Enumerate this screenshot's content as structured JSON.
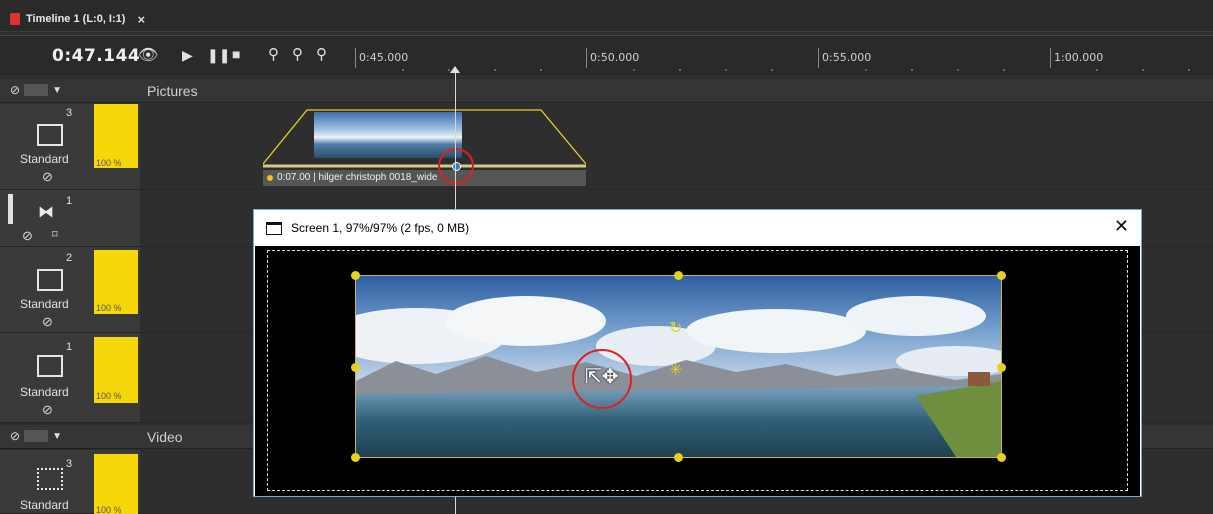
{
  "tab": {
    "title": "Timeline 1 (L:0, I:1)",
    "close": "×"
  },
  "transport": {
    "time": "0:47.144",
    "ruler": [
      "0:45.000",
      "0:50.000",
      "0:55.000",
      "1:00.000"
    ]
  },
  "groups": [
    {
      "title": "Pictures"
    },
    {
      "title": "Video"
    }
  ],
  "tracks": [
    {
      "number": "3",
      "mode": "Standard",
      "opacity": "100 %"
    },
    {
      "number": "1"
    },
    {
      "number": "2",
      "mode": "Standard",
      "opacity": "100 %"
    },
    {
      "number": "1",
      "mode": "Standard",
      "opacity": "100 %"
    },
    {
      "number": "3",
      "mode": "Standard",
      "opacity": "100 %"
    }
  ],
  "clip": {
    "label": "0:07.00 | hilger christoph 0018_wide"
  },
  "screen": {
    "title": "Screen 1, 97%/97% (2 fps, 0 MB)",
    "close": "✕"
  },
  "colors": {
    "accent_yellow": "#f6d70a",
    "tab_red": "#e03131",
    "highlight_red": "#e02020"
  }
}
